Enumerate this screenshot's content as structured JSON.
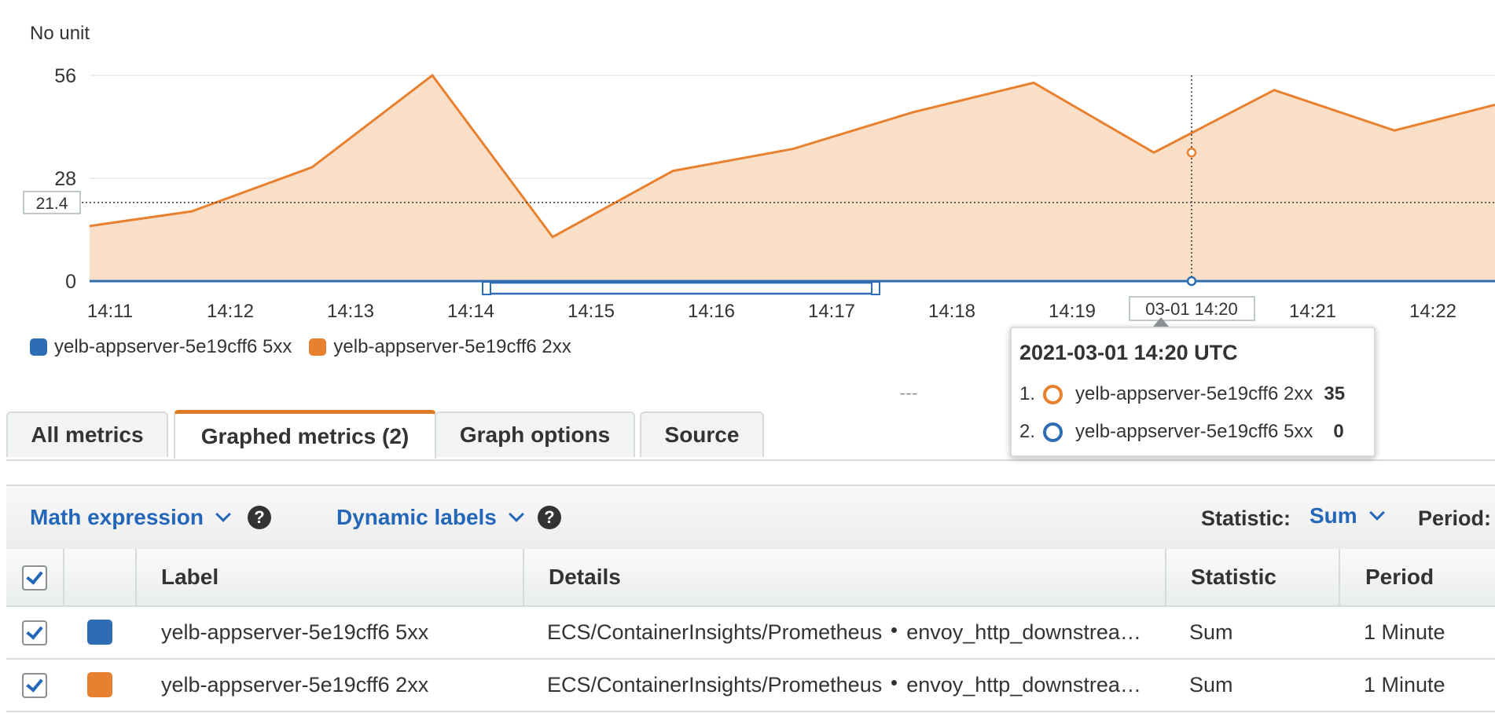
{
  "chart_data": {
    "type": "area",
    "unit_label": "No unit",
    "x": [
      "14:11",
      "14:12",
      "14:13",
      "14:14",
      "14:15",
      "14:16",
      "14:17",
      "14:18",
      "14:19",
      "14:20",
      "14:21",
      "14:22"
    ],
    "x_tick_labels": [
      "14:11",
      "14:12",
      "14:13",
      "14:14",
      "14:15",
      "14:16",
      "14:17",
      "14:18",
      "14:19",
      "14:21",
      "14:22"
    ],
    "ylim": [
      0,
      56
    ],
    "y_ticks": [
      "56",
      "28",
      "0"
    ],
    "threshold_label": "21.4",
    "threshold_value": 21.4,
    "series": [
      {
        "name": "yelb-appserver-5e19cff6 2xx",
        "color": "#e8812f",
        "values": [
          12,
          19,
          31,
          56,
          12,
          30,
          36,
          46,
          54,
          35,
          52,
          41,
          48
        ]
      },
      {
        "name": "yelb-appserver-5e19cff6 5xx",
        "color": "#2e6db4",
        "values": [
          0,
          0,
          0,
          0,
          0,
          0,
          0,
          0,
          0,
          0,
          0,
          0,
          0
        ]
      }
    ],
    "hover_x_label": "03-01 14:20",
    "brush_range": [
      "14:14",
      "14:17"
    ]
  },
  "legend": {
    "items": [
      {
        "label": "yelb-appserver-5e19cff6 5xx",
        "color": "#2e6db4"
      },
      {
        "label": "yelb-appserver-5e19cff6 2xx",
        "color": "#e8812f"
      }
    ]
  },
  "tooltip": {
    "title": "2021-03-01 14:20 UTC",
    "rows": [
      {
        "index": "1.",
        "label": "yelb-appserver-5e19cff6 2xx",
        "value": "35",
        "color": "#e8812f"
      },
      {
        "index": "2.",
        "label": "yelb-appserver-5e19cff6 5xx",
        "value": "0",
        "color": "#2e6db4"
      }
    ]
  },
  "divider_text": "---",
  "tabs": [
    {
      "label": "All metrics"
    },
    {
      "label": "Graphed metrics (2)"
    },
    {
      "label": "Graph options"
    },
    {
      "label": "Source"
    }
  ],
  "toolbar": {
    "math_expression": "Math expression",
    "dynamic_labels": "Dynamic labels",
    "help": "?",
    "statistic_label": "Statistic:",
    "statistic_value": "Sum",
    "period_label": "Period:"
  },
  "table": {
    "headers": {
      "label": "Label",
      "details": "Details",
      "statistic": "Statistic",
      "period": "Period"
    },
    "rows": [
      {
        "label": "yelb-appserver-5e19cff6 5xx",
        "color": "#2e6db4",
        "namespace": "ECS/ContainerInsights/Prometheus",
        "metric": "envoy_http_downstrea…",
        "statistic": "Sum",
        "period": "1 Minute"
      },
      {
        "label": "yelb-appserver-5e19cff6 2xx",
        "color": "#e8812f",
        "namespace": "ECS/ContainerInsights/Prometheus",
        "metric": "envoy_http_downstrea…",
        "statistic": "Sum",
        "period": "1 Minute"
      }
    ]
  }
}
